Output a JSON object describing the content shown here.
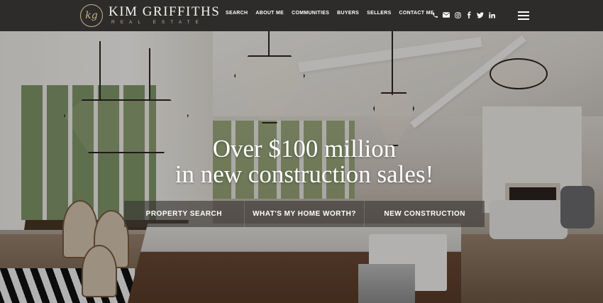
{
  "brand": {
    "name": "KIM GRIFFITHS",
    "sub": "REAL ESTATE",
    "monogram": "kg"
  },
  "nav": {
    "items": [
      "SEARCH",
      "ABOUT ME",
      "COMMUNITIES",
      "BUYERS",
      "SELLERS",
      "CONTACT ME"
    ]
  },
  "social": {
    "icons": [
      "phone-icon",
      "email-icon",
      "instagram-icon",
      "facebook-icon",
      "twitter-icon",
      "linkedin-icon"
    ]
  },
  "hero": {
    "headline_line1": "Over $100 million",
    "headline_line2": "in new construction sales!"
  },
  "cta": {
    "items": [
      "PROPERTY SEARCH",
      "WHAT'S MY HOME WORTH?",
      "NEW CONSTRUCTION"
    ]
  },
  "colors": {
    "topbar": "#2d2c2b",
    "accent_gold": "#c8b48a",
    "text": "#ffffff"
  }
}
